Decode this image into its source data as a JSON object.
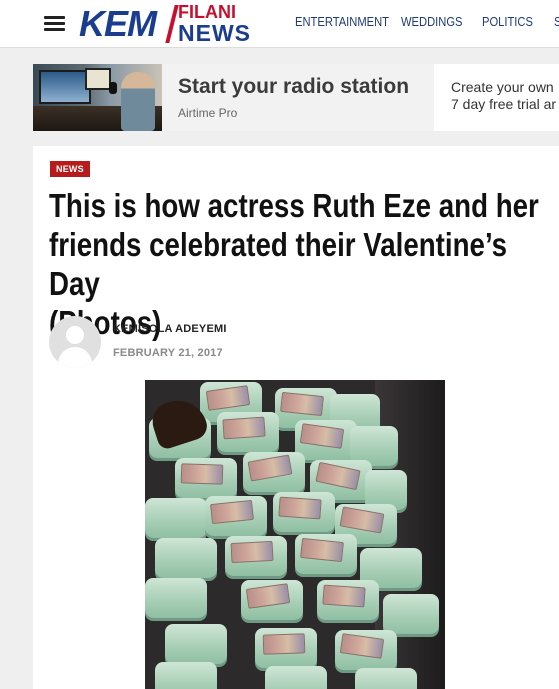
{
  "header": {
    "logo": {
      "part1": "KEM",
      "part2_top": "FILANI",
      "part2_bottom": "NEWS"
    },
    "nav": [
      "ENTERTAINMENT",
      "WEDDINGS",
      "POLITICS",
      "S"
    ]
  },
  "ad": {
    "title": "Start your radio station",
    "sponsor": "Airtime Pro",
    "desc_line1": "Create your own",
    "desc_line2": "7 day free trial ar"
  },
  "article": {
    "category": "NEWS",
    "headline_line1": "This is how actress Ruth Eze and her",
    "headline_line2": "friends celebrated their Valentine’s Day",
    "headline_line3": "(Photos)",
    "author": "KEMISOLA ADEYEMI",
    "date": "FEBRUARY 21, 2017"
  },
  "colors": {
    "brand_blue": "#1a3d8f",
    "brand_red": "#c8102e",
    "badge_red": "#b71c1c"
  },
  "icons": [
    "hamburger-menu-icon",
    "avatar-placeholder-icon"
  ]
}
